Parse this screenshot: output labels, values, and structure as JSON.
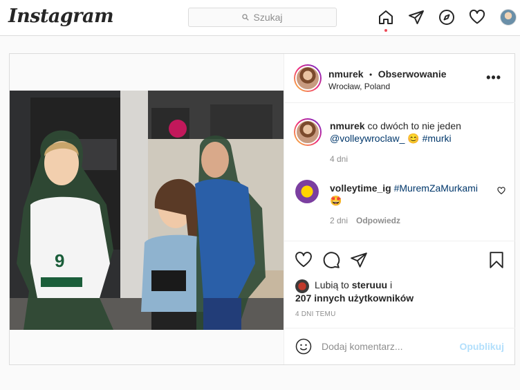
{
  "header": {
    "logo": "Instagram",
    "search_placeholder": "Szukaj"
  },
  "post": {
    "author": "nmurek",
    "separator": "•",
    "follow_status": "Obserwowanie",
    "location": "Wrocław, Poland",
    "caption": {
      "username": "nmurek",
      "text": "co dwóch to nie jeden",
      "mention": "@volleywroclaw_",
      "emoji": "😊",
      "hashtag": "#murki",
      "age": "4 dni"
    },
    "comments": [
      {
        "username": "volleytime_ig",
        "hashtag": "#MuremZaMurkami",
        "emoji": "🤩",
        "age": "2 dni",
        "reply_label": "Odpowiedz"
      }
    ],
    "likes": {
      "prefix": "Lubią to",
      "user": "steruuu",
      "joiner": "i",
      "others": "207 innych użytkowników"
    },
    "timestamp": "4 DNI TEMU",
    "add_comment_placeholder": "Dodaj komentarz...",
    "publish_label": "Opublikuj",
    "photo_jersey_number": "9"
  },
  "icons": {
    "nav": [
      "home-icon",
      "direct-icon",
      "explore-icon",
      "activity-heart-icon",
      "profile-avatar"
    ],
    "actions": [
      "like-heart-icon",
      "comment-icon",
      "share-icon",
      "save-bookmark-icon"
    ]
  },
  "colors": {
    "link": "#00376b",
    "publish_disabled": "#b2dffc",
    "notification_dot": "#ed4956",
    "border": "#dbdbdb"
  }
}
